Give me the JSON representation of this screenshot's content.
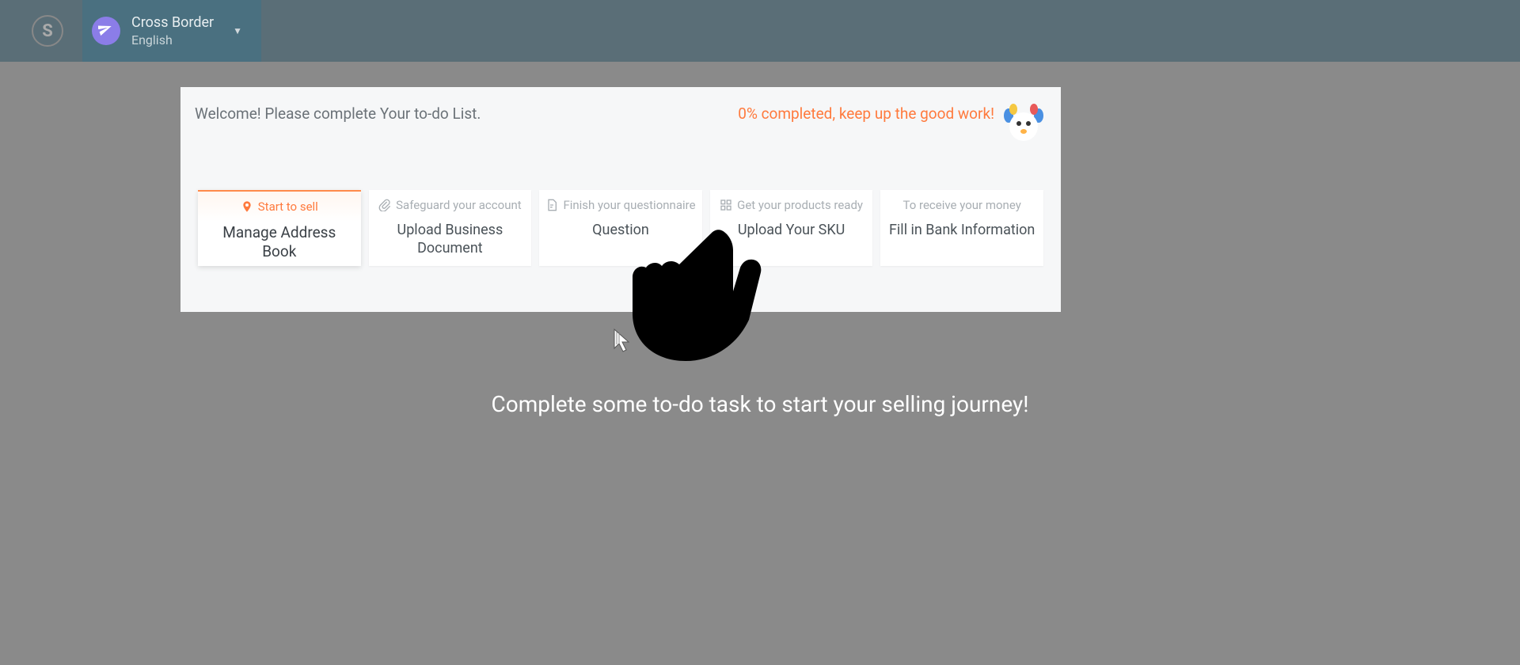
{
  "header": {
    "locale_title": "Cross Border",
    "locale_lang": "English"
  },
  "panel": {
    "welcome": "Welcome! Please complete Your to-do List.",
    "progress": "0% completed, keep up the good work!"
  },
  "cards": [
    {
      "header": "Start to sell",
      "task": "Manage Address Book",
      "active": true
    },
    {
      "header": "Safeguard your account",
      "task": "Upload Business Document",
      "active": false
    },
    {
      "header": "Finish your questionnaire",
      "task": "Question",
      "active": false
    },
    {
      "header": "Get your products ready",
      "task": "Upload Your SKU",
      "active": false
    },
    {
      "header": "To receive your money",
      "task": "Fill in Bank Information",
      "active": false
    }
  ],
  "cta": "Complete some to-do task to start your selling journey!"
}
